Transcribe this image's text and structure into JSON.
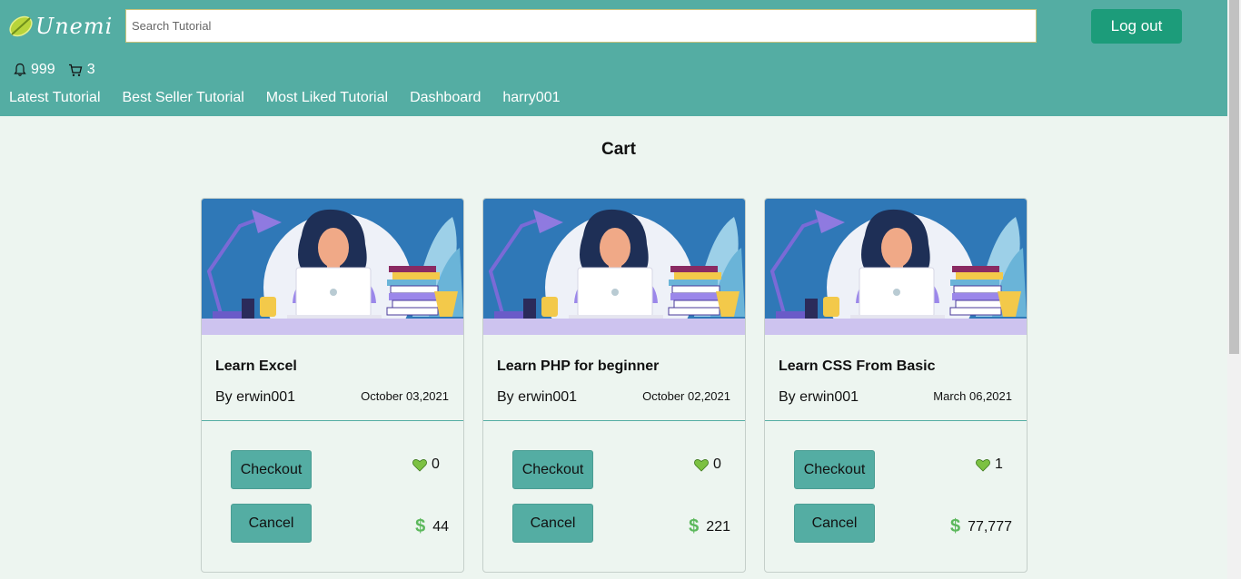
{
  "header": {
    "logo_text": "Unemi",
    "search_placeholder": "Search Tutorial",
    "logout_label": "Log out",
    "notifications_count": "999",
    "cart_count": "3"
  },
  "nav": [
    {
      "label": "Latest Tutorial"
    },
    {
      "label": "Best Seller Tutorial"
    },
    {
      "label": "Most Liked Tutorial"
    },
    {
      "label": "Dashboard"
    },
    {
      "label": "harry001"
    }
  ],
  "page_title": "Cart",
  "cards": [
    {
      "title": "Learn Excel",
      "author": "By erwin001",
      "date": "October 03,2021",
      "checkout_label": "Checkout",
      "cancel_label": "Cancel",
      "likes": "0",
      "price": "44"
    },
    {
      "title": "Learn PHP for beginner",
      "author": "By erwin001",
      "date": "October 02,2021",
      "checkout_label": "Checkout",
      "cancel_label": "Cancel",
      "likes": "0",
      "price": "221"
    },
    {
      "title": "Learn CSS From Basic",
      "author": "By erwin001",
      "date": "March 06,2021",
      "checkout_label": "Checkout",
      "cancel_label": "Cancel",
      "likes": "1",
      "price": "77,777"
    }
  ],
  "colors": {
    "header": "#54ada3",
    "logout": "#1c9c7a",
    "background": "#edf5f0",
    "like_heart": "#7cc142",
    "dollar": "#5cb85c"
  },
  "icons": {
    "logo": "leaf-icon",
    "notifications": "bell-icon",
    "cart": "cart-icon",
    "likes": "heart-icon",
    "price": "dollar-icon"
  }
}
